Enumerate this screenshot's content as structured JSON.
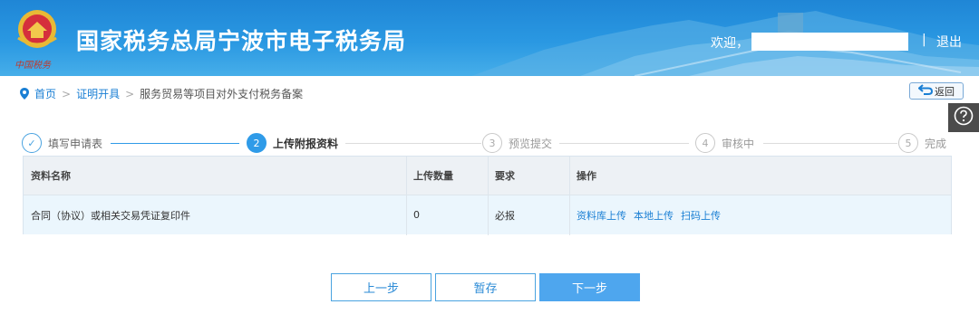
{
  "header": {
    "title": "国家税务总局宁波市电子税务局",
    "welcome": "欢迎，",
    "separator": "|",
    "logout": "退出",
    "emblem_text": "中国税务"
  },
  "breadcrumb": {
    "home": "首页",
    "level1": "证明开具",
    "current": "服务贸易等项目对外支付税务备案",
    "arrow": ">"
  },
  "back_label": "返回",
  "help_icon": "question-icon",
  "steps": [
    {
      "num": "✓",
      "label": "填写申请表",
      "state": "done"
    },
    {
      "num": "2",
      "label": "上传附报资料",
      "state": "active"
    },
    {
      "num": "3",
      "label": "预览提交",
      "state": "pending"
    },
    {
      "num": "4",
      "label": "审核中",
      "state": "pending"
    },
    {
      "num": "5",
      "label": "完成",
      "state": "pending"
    }
  ],
  "table": {
    "headers": [
      "资料名称",
      "上传数量",
      "要求",
      "操作"
    ],
    "rows": [
      {
        "name": "合同（协议）或相关交易凭证复印件",
        "count": "0",
        "requirement": "必报",
        "actions": [
          "资料库上传",
          "本地上传",
          "扫码上传"
        ]
      }
    ]
  },
  "buttons": {
    "prev": "上一步",
    "save": "暂存",
    "next": "下一步"
  },
  "colors": {
    "accent": "#2f9be8",
    "link": "#1a7fd4",
    "banner": "#1f86d6"
  }
}
